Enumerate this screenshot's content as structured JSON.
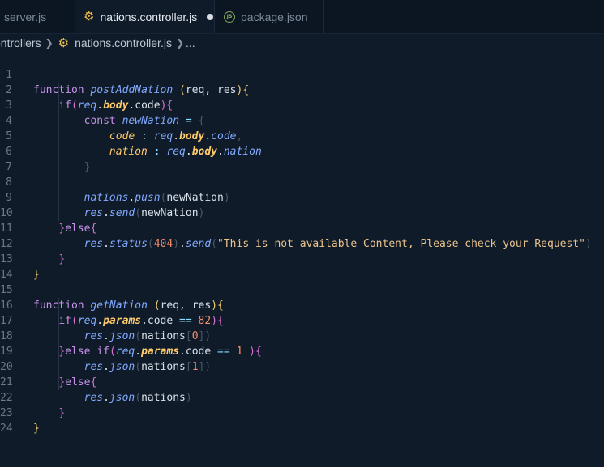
{
  "tabs": [
    {
      "label": "server.js",
      "icon": "none"
    },
    {
      "label": "nations.controller.js",
      "icon": "gear-icon",
      "active": true,
      "modified": true
    },
    {
      "label": "package.json",
      "icon": "js-icon"
    }
  ],
  "breadcrumb": {
    "folder": "ontrollers",
    "file": "nations.controller.js",
    "ellipsis": "..."
  },
  "editor": {
    "line_numbers": [
      "1",
      "2",
      "3",
      "4",
      "5",
      "6",
      "7",
      "8",
      "9",
      "10",
      "11",
      "12",
      "13",
      "14",
      "15",
      "16",
      "17",
      "18",
      "19",
      "20",
      "21",
      "22",
      "23",
      "24"
    ],
    "tokens": {
      "function": "function",
      "postAddNation": "postAddNation",
      "params_open": " (",
      "req": "req",
      "comma_space": ", ",
      "res": "res",
      "params_close": ")",
      "brace_open": "{",
      "brace_close": "}",
      "if": "if",
      "paren_open": "(",
      "paren_close": ")",
      "body": "body",
      "code": "code",
      "dot": ".",
      "const": "const",
      "newNation": "newNation",
      "assign": " = ",
      "code_key": "code",
      "colon": " : ",
      "comma": ",",
      "nation_key": "nation",
      "nation": "nation",
      "nations": "nations",
      "push": "push",
      "send": "send",
      "else": "else",
      "status": "status",
      "n404": "404",
      "message": "\"This is not available Content, Please check your Request\"",
      "getNation": "getNation",
      "params": "params",
      "eq": " == ",
      "n82": "82",
      "json": "json",
      "bracket_open": "[",
      "bracket_close": "]",
      "n0": "0",
      "n1": "1",
      "else_if": "else if",
      "space_paren_close": " )"
    }
  },
  "colors": {
    "background": "#0f1b29",
    "tabbar": "#0b1622",
    "keyword": "#c792ea",
    "function": "#82aaff",
    "property": "#ffcb6b",
    "number": "#f78c6c",
    "string": "#ecc48d"
  }
}
